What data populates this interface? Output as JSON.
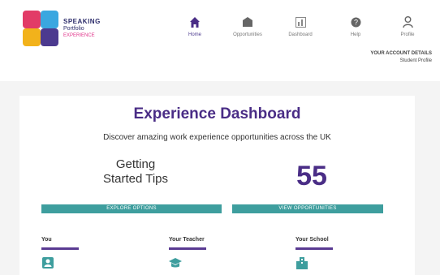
{
  "brand": {
    "line1": "SPEAKING",
    "line2": "Portfolio",
    "line3": "EXPERIENCE"
  },
  "nav": {
    "items": [
      {
        "label": "Home",
        "icon": "home-icon",
        "active": true
      },
      {
        "label": "Opportunities",
        "icon": "building-icon",
        "active": false
      },
      {
        "label": "Dashboard",
        "icon": "dashboard-icon",
        "active": false
      },
      {
        "label": "Help",
        "icon": "help-icon",
        "active": false
      },
      {
        "label": "Profile",
        "icon": "profile-icon",
        "active": false
      }
    ]
  },
  "account": {
    "line1": "YOUR ACCOUNT DETAILS",
    "line2": "Student    Profile"
  },
  "dashboard": {
    "title": "Experience Dashboard",
    "subtitle": "Discover amazing work experience opportunities across the UK",
    "stat_label_line1": "Getting",
    "stat_label_line2": "Started Tips",
    "stat_value": "55",
    "button1": "EXPLORE OPTIONS",
    "button2": "VIEW OPPORTUNITIES"
  },
  "columns": [
    {
      "title": "You",
      "icon": "person-icon"
    },
    {
      "title": "Your Teacher",
      "icon": "graduation-cap-icon"
    },
    {
      "title": "Your School",
      "icon": "school-building-icon"
    }
  ],
  "colors": {
    "accent": "#4a2d86",
    "teal": "#3e9e9e",
    "background": "#f4f4f4"
  }
}
